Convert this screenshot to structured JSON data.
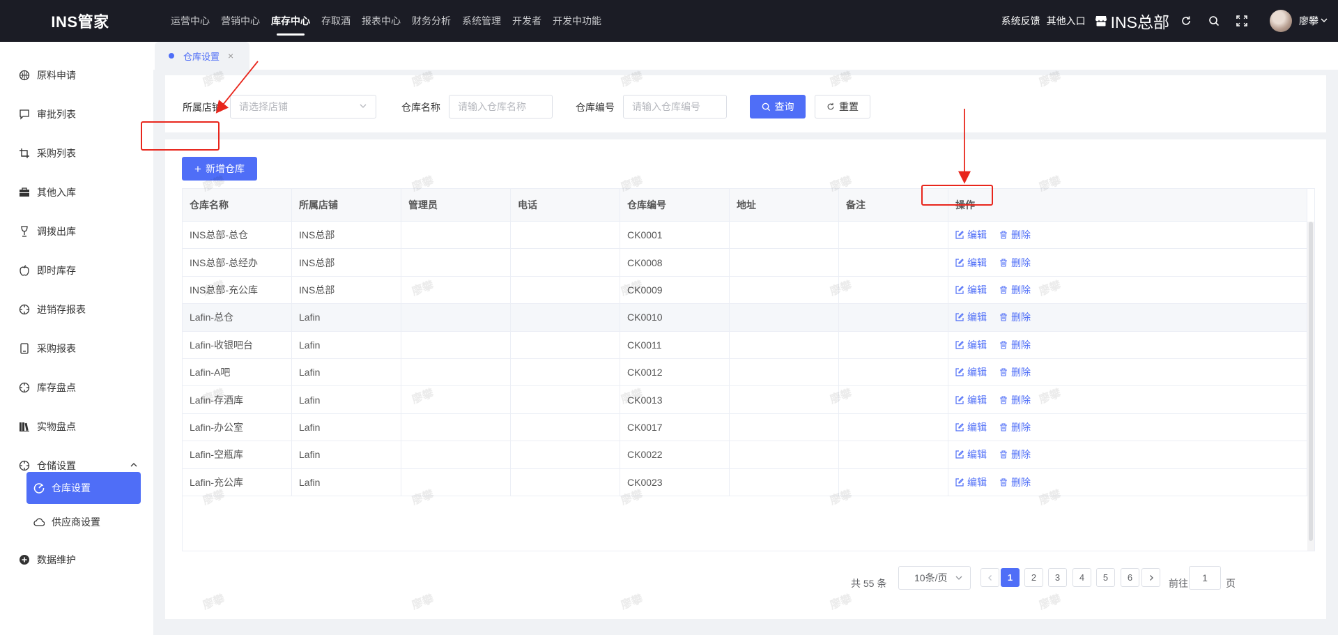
{
  "app": {
    "logo": "INS管家"
  },
  "topnav": {
    "items": [
      "运营中心",
      "营销中心",
      "库存中心",
      "存取酒",
      "报表中心",
      "财务分析",
      "系统管理",
      "开发者",
      "开发中功能"
    ],
    "active": "库存中心"
  },
  "topright": {
    "feedback": "系统反馈",
    "other_entry": "其他入口",
    "shop_name": "INS总部",
    "user_name": "廖攀",
    "icons": [
      "store-icon",
      "refresh-icon",
      "search-icon",
      "fullscreen-icon",
      "chevron-down-icon"
    ]
  },
  "sidebar": {
    "items": [
      {
        "label": "原料申请",
        "icon": "basketball-icon"
      },
      {
        "label": "审批列表",
        "icon": "chat-icon"
      },
      {
        "label": "采购列表",
        "icon": "crop-icon"
      },
      {
        "label": "其他入库",
        "icon": "briefcase-icon"
      },
      {
        "label": "调拨出库",
        "icon": "cup-icon"
      },
      {
        "label": "即时库存",
        "icon": "apple-icon"
      },
      {
        "label": "进销存报表",
        "icon": "target-icon"
      },
      {
        "label": "采购报表",
        "icon": "phone-icon"
      },
      {
        "label": "库存盘点",
        "icon": "target-icon"
      },
      {
        "label": "实物盘点",
        "icon": "books-icon"
      },
      {
        "label": "仓储设置",
        "icon": "target-icon"
      }
    ],
    "sub_items": [
      {
        "label": "仓库设置",
        "icon": "gauge-icon",
        "active": true
      },
      {
        "label": "供应商设置",
        "icon": "cloud-icon",
        "active": false
      }
    ],
    "last_item": {
      "label": "数据维护",
      "icon": "plus-circle-icon"
    }
  },
  "tabs": [
    {
      "label": "仓库设置",
      "closable": true
    }
  ],
  "search": {
    "store_label": "所属店铺",
    "store_placeholder": "请选择店铺",
    "name_label": "仓库名称",
    "name_placeholder": "请输入仓库名称",
    "code_label": "仓库编号",
    "code_placeholder": "请输入仓库编号",
    "query_button": "查询",
    "reset_button": "重置"
  },
  "toolbar": {
    "add_button": "新增仓库"
  },
  "table": {
    "columns": [
      "仓库名称",
      "所属店铺",
      "管理员",
      "电话",
      "仓库编号",
      "地址",
      "备注",
      "操作"
    ],
    "rows": [
      {
        "name": "INS总部-总仓",
        "store": "INS总部",
        "admin": "",
        "phone": "",
        "code": "CK0001",
        "address": "",
        "remark": ""
      },
      {
        "name": "INS总部-总经办",
        "store": "INS总部",
        "admin": "",
        "phone": "",
        "code": "CK0008",
        "address": "",
        "remark": ""
      },
      {
        "name": "INS总部-充公库",
        "store": "INS总部",
        "admin": "",
        "phone": "",
        "code": "CK0009",
        "address": "",
        "remark": ""
      },
      {
        "name": "Lafin-总仓",
        "store": "Lafin",
        "admin": "",
        "phone": "",
        "code": "CK0010",
        "address": "",
        "remark": ""
      },
      {
        "name": "Lafin-收银吧台",
        "store": "Lafin",
        "admin": "",
        "phone": "",
        "code": "CK0011",
        "address": "",
        "remark": ""
      },
      {
        "name": "Lafin-A吧",
        "store": "Lafin",
        "admin": "",
        "phone": "",
        "code": "CK0012",
        "address": "",
        "remark": ""
      },
      {
        "name": "Lafin-存酒库",
        "store": "Lafin",
        "admin": "",
        "phone": "",
        "code": "CK0013",
        "address": "",
        "remark": ""
      },
      {
        "name": "Lafin-办公室",
        "store": "Lafin",
        "admin": "",
        "phone": "",
        "code": "CK0017",
        "address": "",
        "remark": ""
      },
      {
        "name": "Lafin-空瓶库",
        "store": "Lafin",
        "admin": "",
        "phone": "",
        "code": "CK0022",
        "address": "",
        "remark": ""
      },
      {
        "name": "Lafin-充公库",
        "store": "Lafin",
        "admin": "",
        "phone": "",
        "code": "CK0023",
        "address": "",
        "remark": ""
      }
    ],
    "edit_label": "编辑",
    "delete_label": "删除",
    "hover_row": 3
  },
  "pagination": {
    "total_text": "共 55 条",
    "page_size": "10条/页",
    "pages": [
      "1",
      "2",
      "3",
      "4",
      "5",
      "6"
    ],
    "current": "1",
    "goto_label": "前往",
    "goto_value": "1",
    "page_suffix": "页"
  },
  "watermark": "廖攀",
  "colors": {
    "primary": "#4f6ef7",
    "topbar": "#1b1c25",
    "annotation": "#e8261c"
  }
}
